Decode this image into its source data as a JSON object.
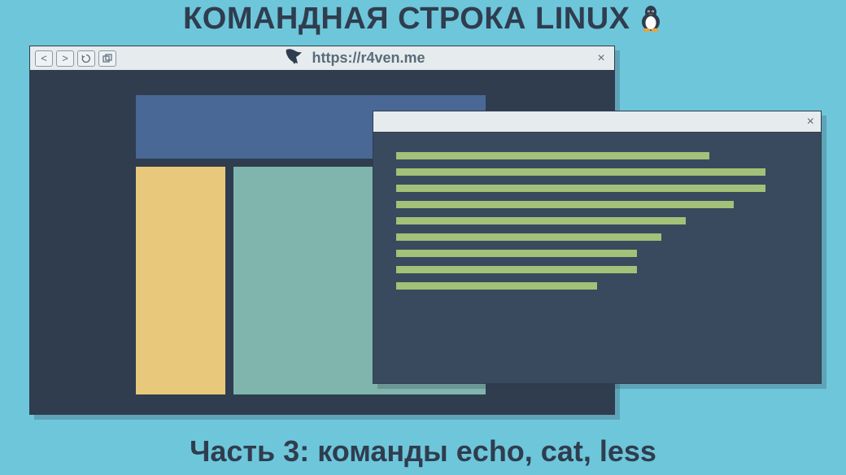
{
  "header": {
    "title": "КОМАНДНАЯ СТРОКА LINUX",
    "icon": "tux-penguin-icon"
  },
  "footer": {
    "subtitle": "Часть 3: команды echo, cat, less"
  },
  "browser": {
    "back_label": "<",
    "forward_label": ">",
    "reload_icon": "reload-icon",
    "tabs_icon": "tabs-icon",
    "url": "https://r4ven.me",
    "close_label": "×",
    "logo": "raven-icon"
  },
  "terminal": {
    "close_label": "×",
    "lines": [
      {
        "width_percent": 78
      },
      {
        "width_percent": 92
      },
      {
        "width_percent": 92
      },
      {
        "width_percent": 84
      },
      {
        "width_percent": 72
      },
      {
        "width_percent": 66
      },
      {
        "width_percent": 60
      },
      {
        "width_percent": 60
      },
      {
        "width_percent": 50
      }
    ]
  },
  "colors": {
    "background": "#6ec6da",
    "dark": "#2f3d4f",
    "terminal_bg": "#3a4a5e",
    "terminal_line": "#a3c178",
    "panel_blue": "#4a6896",
    "panel_yellow": "#e8c87a",
    "panel_teal": "#7fb5ad",
    "chrome": "#e6eced"
  }
}
